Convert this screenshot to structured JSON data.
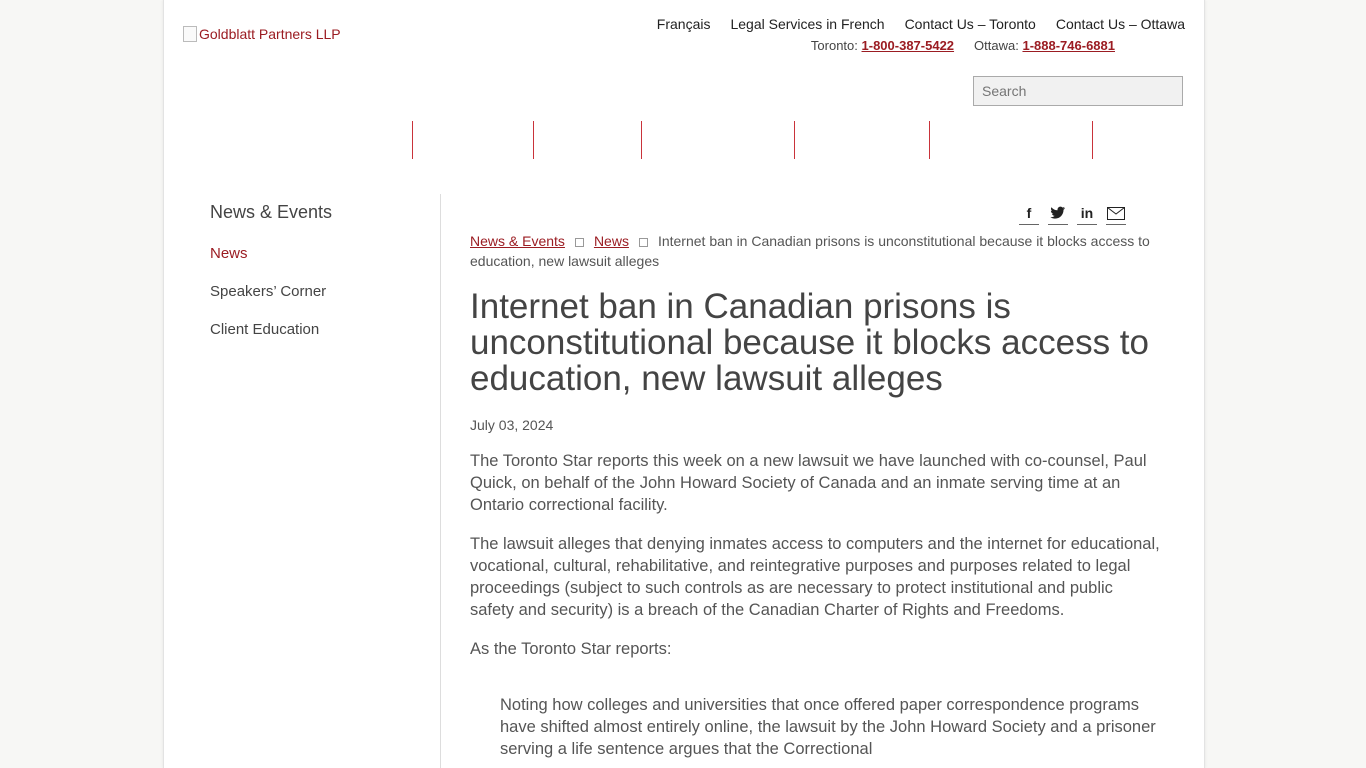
{
  "logo": {
    "alt": "Goldblatt Partners LLP"
  },
  "topnav": [
    "Français",
    "Legal Services in French",
    "Contact Us – Toronto",
    "Contact Us – Ottawa"
  ],
  "phones": [
    {
      "label": "Toronto:",
      "number": "1-800-387-5422"
    },
    {
      "label": "Ottawa:",
      "number": "1-888-746-6881"
    }
  ],
  "search": {
    "placeholder": "Search"
  },
  "sidebar": {
    "title": "News & Events",
    "items": [
      {
        "label": "News",
        "active": true
      },
      {
        "label": "Speakers’ Corner"
      },
      {
        "label": "Client Education"
      }
    ]
  },
  "share_icons": [
    "facebook-icon",
    "twitter-icon",
    "linkedin-icon",
    "email-icon"
  ],
  "breadcrumb": {
    "items": [
      "News & Events",
      "News"
    ],
    "current": "Internet ban in Canadian prisons is unconstitutional because it blocks access to education, new lawsuit alleges"
  },
  "article": {
    "title": "Internet ban in Canadian prisons is unconstitutional because it blocks access to education, new lawsuit alleges",
    "date": "July 03, 2024",
    "paragraphs": [
      "The Toronto Star reports this week on a new lawsuit we have launched with co-counsel, Paul Quick, on behalf of the John Howard Society of Canada and an inmate serving time at an Ontario correctional facility.",
      "The lawsuit alleges that denying inmates access to computers and the internet for educational, vocational, cultural, rehabilitative, and reintegrative purposes and purposes related to legal proceedings (subject to such controls as are necessary to protect institutional and public safety and security) is a breach of the Canadian Charter of Rights and Freedoms.",
      "As the Toronto Star reports:"
    ],
    "quote": "Noting how colleges and universities that once offered paper correspondence programs have shifted almost entirely online, the lawsuit by the John Howard Society and a prisoner serving a life sentence argues that the Correctional"
  },
  "colors": {
    "accent": "#9b1c22",
    "text": "#555555"
  }
}
